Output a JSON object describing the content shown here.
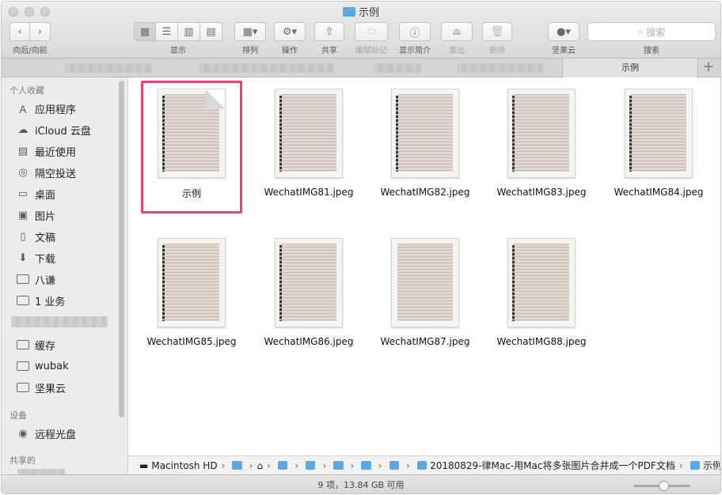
{
  "window": {
    "title": "示例"
  },
  "toolbar": {
    "nav_label": "向后/向前",
    "view_label": "显示",
    "arrange_label": "排列",
    "action_label": "操作",
    "share_label": "共享",
    "tags_label": "编辑标记",
    "info_label": "显示简介",
    "eject_label": "推出",
    "delete_label": "删除",
    "jianguoyun_label": "坚果云",
    "search_label": "搜索",
    "search_placeholder": "搜索"
  },
  "tabs": {
    "active": "示例",
    "add": "+"
  },
  "sidebar": {
    "favorites_heading": "个人收藏",
    "favorites": [
      {
        "label": "应用程序",
        "icon": "applications-icon"
      },
      {
        "label": "iCloud 云盘",
        "icon": "cloud-icon"
      },
      {
        "label": "最近使用",
        "icon": "recents-icon"
      },
      {
        "label": "隔空投送",
        "icon": "airdrop-icon"
      },
      {
        "label": "桌面",
        "icon": "desktop-icon"
      },
      {
        "label": "图片",
        "icon": "pictures-icon"
      },
      {
        "label": "文稿",
        "icon": "documents-icon"
      },
      {
        "label": "下载",
        "icon": "downloads-icon"
      },
      {
        "label": "八谦",
        "icon": "folder-icon"
      },
      {
        "label": "1 业务",
        "icon": "folder-icon"
      },
      {
        "label": "缓存",
        "icon": "folder-icon"
      },
      {
        "label": "wubak",
        "icon": "folder-icon"
      },
      {
        "label": "坚果云",
        "icon": "folder-icon"
      }
    ],
    "devices_heading": "设备",
    "devices": [
      {
        "label": "远程光盘",
        "icon": "remote-disc-icon"
      }
    ],
    "shared_heading": "共享的"
  },
  "files": [
    {
      "name": "示例",
      "selected": true,
      "kind": "folder-doc"
    },
    {
      "name": "WechatIMG81.jpeg"
    },
    {
      "name": "WechatIMG82.jpeg"
    },
    {
      "name": "WechatIMG83.jpeg"
    },
    {
      "name": "WechatIMG84.jpeg"
    },
    {
      "name": "WechatIMG85.jpeg"
    },
    {
      "name": "WechatIMG86.jpeg"
    },
    {
      "name": "WechatIMG87.jpeg"
    },
    {
      "name": "WechatIMG88.jpeg"
    }
  ],
  "pathbar": {
    "disk": "Macintosh HD",
    "folder_long": "20180829-律Mac-用Mac将多张图片合并成一个PDF文档",
    "current": "示例"
  },
  "status": {
    "text": "9 项，13.84 GB 可用"
  },
  "colors": {
    "selection": "#e8427a",
    "folder_blue": "#5aa9e6"
  }
}
